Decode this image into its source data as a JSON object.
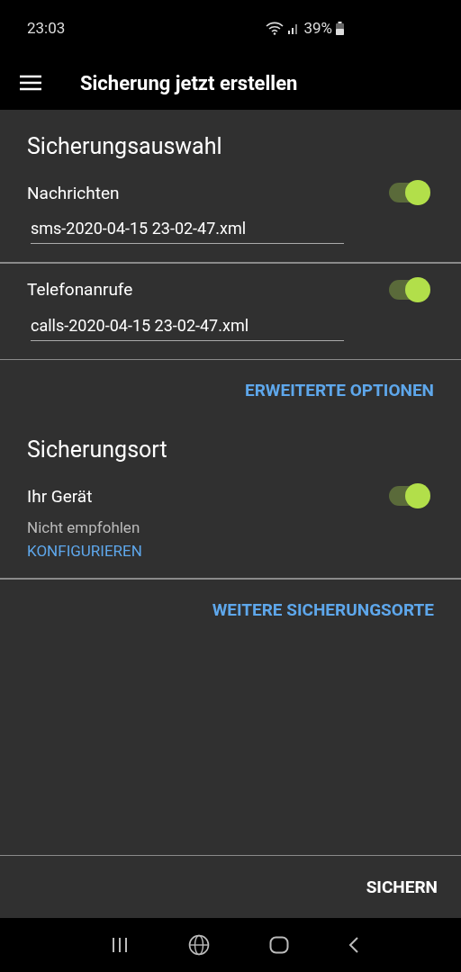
{
  "status_bar": {
    "time": "23:03",
    "battery": "39%"
  },
  "app_bar": {
    "title": "Sicherung jetzt erstellen"
  },
  "backup_selection": {
    "heading": "Sicherungsauswahl",
    "items": [
      {
        "label": "Nachrichten",
        "on": true,
        "filename": "sms-2020-04-15 23-02-47.xml"
      },
      {
        "label": "Telefonanrufe",
        "on": true,
        "filename": "calls-2020-04-15 23-02-47.xml"
      }
    ],
    "action": "ERWEITERTE OPTIONEN"
  },
  "backup_location": {
    "heading": "Sicherungsort",
    "items": [
      {
        "label": "Ihr Gerät",
        "on": true,
        "note": "Nicht empfohlen",
        "link": "KONFIGURIEREN"
      }
    ],
    "action": "WEITERE SICHERUNGSORTE"
  },
  "footer": {
    "button": "SICHERN"
  }
}
